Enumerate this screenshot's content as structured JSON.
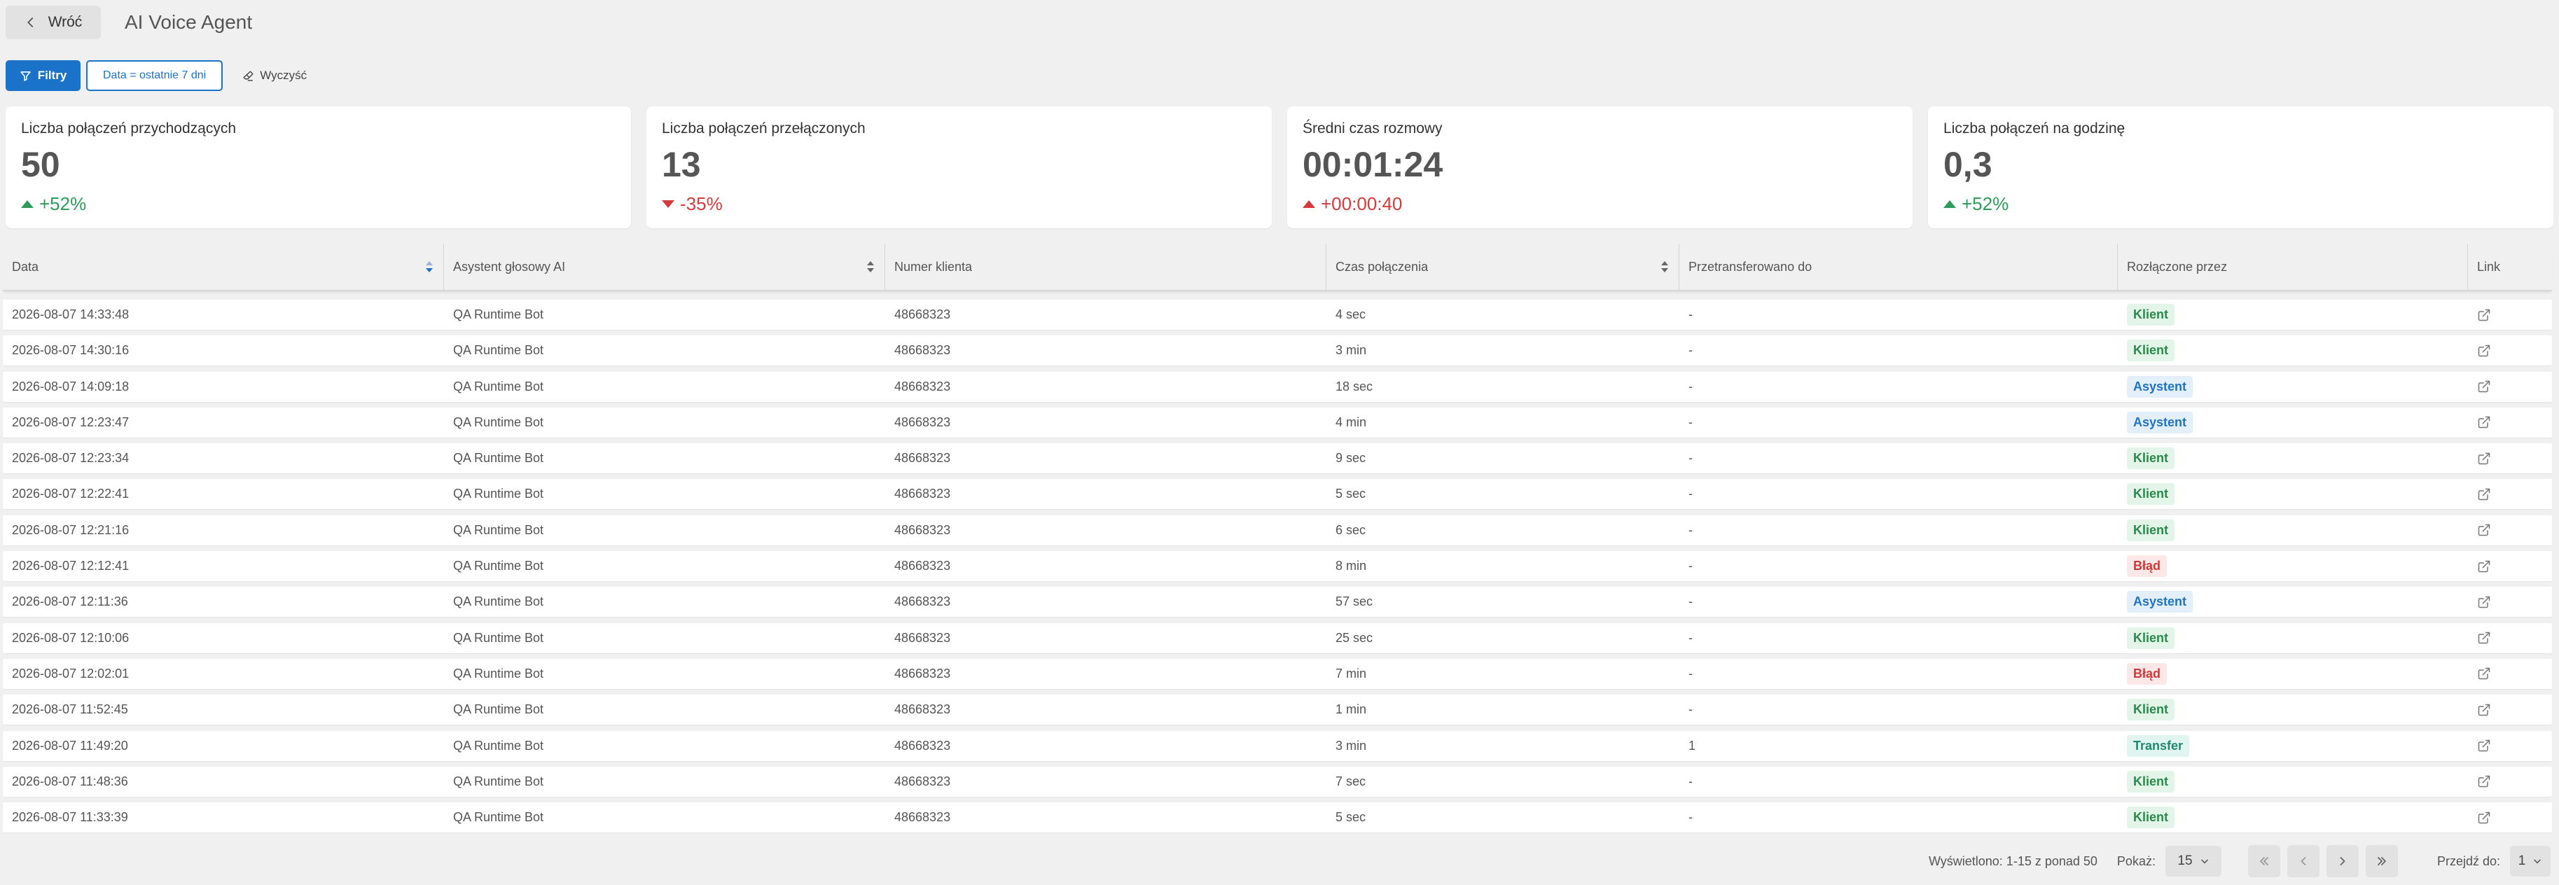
{
  "header": {
    "back_label": "Wróć",
    "title": "AI Voice Agent"
  },
  "filters": {
    "filters_label": "Filtry",
    "date_chip": "Data = ostatnie 7 dni",
    "clear_label": "Wyczyść"
  },
  "kpis": [
    {
      "title": "Liczba połączeń przychodzących",
      "value": "50",
      "change": "+52%",
      "direction": "up"
    },
    {
      "title": "Liczba połączeń przełączonych",
      "value": "13",
      "change": "-35%",
      "direction": "down"
    },
    {
      "title": "Średni czas rozmowy",
      "value": "00:01:24",
      "change": "+00:00:40",
      "direction": "up-bad"
    },
    {
      "title": "Liczba połączeń na godzinę",
      "value": "0,3",
      "change": "+52%",
      "direction": "up"
    }
  ],
  "table": {
    "columns": [
      "Data",
      "Asystent głosowy AI",
      "Numer klienta",
      "Czas połączenia",
      "Przetransferowano do",
      "Rozłączone przez",
      "Link"
    ],
    "rows": [
      [
        "2026-08-07 14:33:48",
        "QA Runtime Bot",
        "48668323",
        "4 sec",
        "-",
        "Klient"
      ],
      [
        "2026-08-07 14:30:16",
        "QA Runtime Bot",
        "48668323",
        "3 min",
        "-",
        "Klient"
      ],
      [
        "2026-08-07 14:09:18",
        "QA Runtime Bot",
        "48668323",
        "18 sec",
        "-",
        "Asystent"
      ],
      [
        "2026-08-07 12:23:47",
        "QA Runtime Bot",
        "48668323",
        "4 min",
        "-",
        "Asystent"
      ],
      [
        "2026-08-07 12:23:34",
        "QA Runtime Bot",
        "48668323",
        "9 sec",
        "-",
        "Klient"
      ],
      [
        "2026-08-07 12:22:41",
        "QA Runtime Bot",
        "48668323",
        "5 sec",
        "-",
        "Klient"
      ],
      [
        "2026-08-07 12:21:16",
        "QA Runtime Bot",
        "48668323",
        "6 sec",
        "-",
        "Klient"
      ],
      [
        "2026-08-07 12:12:41",
        "QA Runtime Bot",
        "48668323",
        "8 min",
        "-",
        "Błąd"
      ],
      [
        "2026-08-07 12:11:36",
        "QA Runtime Bot",
        "48668323",
        "57 sec",
        "-",
        "Asystent"
      ],
      [
        "2026-08-07 12:10:06",
        "QA Runtime Bot",
        "48668323",
        "25 sec",
        "-",
        "Klient"
      ],
      [
        "2026-08-07 12:02:01",
        "QA Runtime Bot",
        "48668323",
        "7 min",
        "-",
        "Błąd"
      ],
      [
        "2026-08-07 11:52:45",
        "QA Runtime Bot",
        "48668323",
        "1 min",
        "-",
        "Klient"
      ],
      [
        "2026-08-07 11:49:20",
        "QA Runtime Bot",
        "48668323",
        "3 min",
        "1",
        "Transfer"
      ],
      [
        "2026-08-07 11:48:36",
        "QA Runtime Bot",
        "48668323",
        "7 sec",
        "-",
        "Klient"
      ],
      [
        "2026-08-07 11:33:39",
        "QA Runtime Bot",
        "48668323",
        "5 sec",
        "-",
        "Klient"
      ]
    ]
  },
  "pagination": {
    "summary": "Wyświetlono: 1-15 z ponad 50",
    "show_label": "Pokaż:",
    "page_size": "15",
    "goto_label": "Przejdź do:",
    "page": "1"
  },
  "colors": {
    "primary": "#1a73c8",
    "positive": "#2d9c5a",
    "negative": "#d63b3b",
    "background": "#f0f0f0"
  }
}
